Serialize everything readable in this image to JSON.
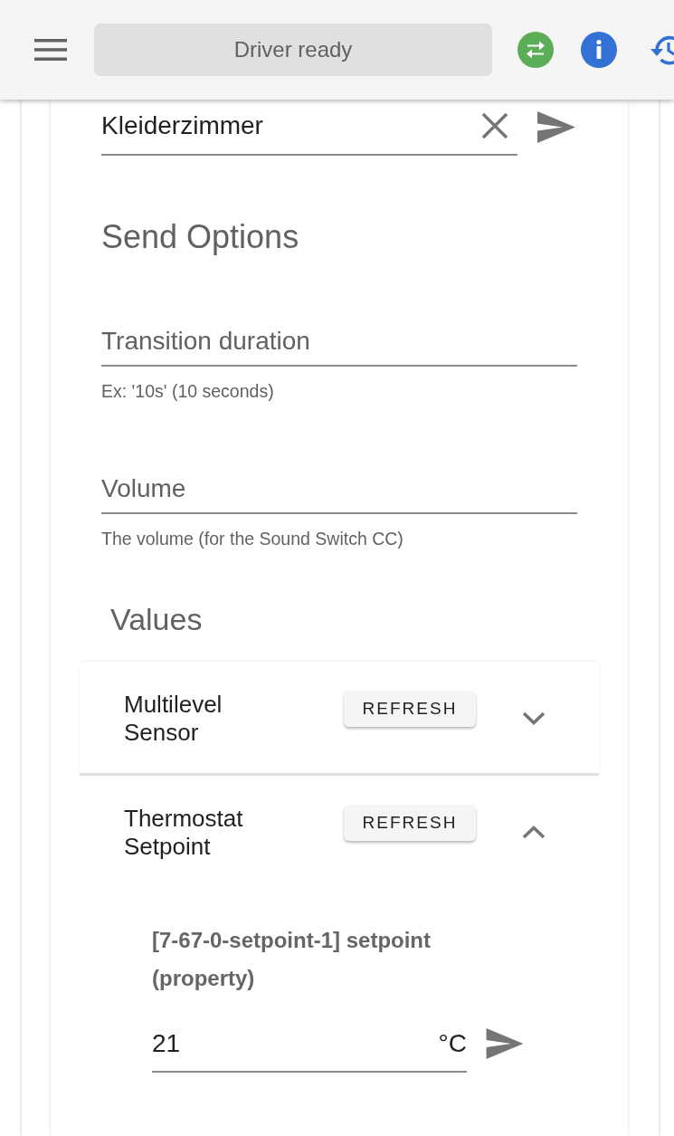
{
  "toolbar": {
    "status": "Driver ready"
  },
  "name_field": {
    "value": "Kleiderzimmer"
  },
  "send_options": {
    "title": "Send Options",
    "fields": [
      {
        "placeholder": "Transition duration",
        "hint": "Ex: '10s' (10 seconds)"
      },
      {
        "placeholder": "Volume",
        "hint": "The volume (for the Sound Switch CC)"
      }
    ]
  },
  "values": {
    "title": "Values",
    "panels": [
      {
        "title": "Multilevel Sensor",
        "button": "REFRESH",
        "expanded": false
      },
      {
        "title": "Thermostat Setpoint",
        "button": "REFRESH",
        "expanded": true,
        "items": [
          {
            "label": "[7-67-0-setpoint-1] setpoint (property)",
            "value": "21",
            "unit": "°C"
          }
        ]
      }
    ]
  }
}
